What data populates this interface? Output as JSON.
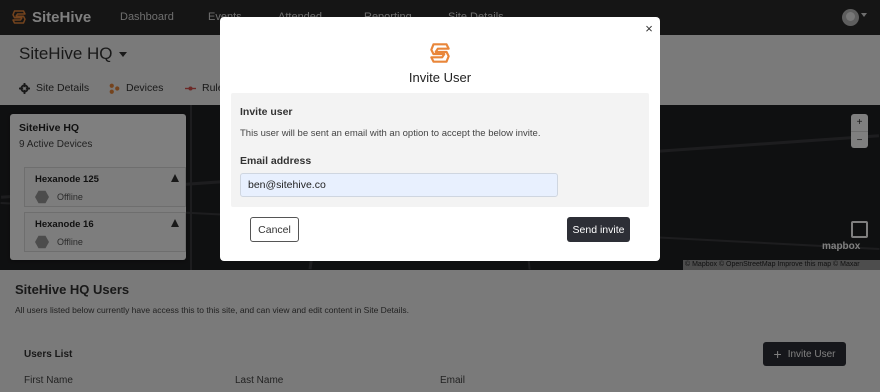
{
  "app": {
    "name": "SiteHive"
  },
  "nav": {
    "links": [
      "Dashboard",
      "Events",
      "Attended",
      "Reporting",
      "Site Details"
    ]
  },
  "site": {
    "title": "SiteHive HQ"
  },
  "subnav": {
    "items": [
      "Site Details",
      "Devices",
      "Rules"
    ]
  },
  "map_card": {
    "title": "SiteHive HQ",
    "count": "9 Active Devices",
    "devices": [
      {
        "name": "Hexanode 125",
        "status": "Offline"
      },
      {
        "name": "Hexanode 16",
        "status": "Offline"
      }
    ]
  },
  "map": {
    "zoom_in": "+",
    "zoom_out": "−",
    "logo": "mapbox",
    "attribution": "© Mapbox © OpenStreetMap Improve this map © Maxar"
  },
  "users": {
    "title": "SiteHive HQ Users",
    "description": "All users listed below currently have access this to this site, and can view and edit content in Site Details.",
    "list_title": "Users List",
    "invite_label": "Invite User",
    "columns": [
      "First Name",
      "Last Name",
      "Email"
    ]
  },
  "modal": {
    "title": "Invite User",
    "close": "×",
    "heading": "Invite user",
    "description": "This user will be sent an email with an option to accept the below invite.",
    "email_label": "Email address",
    "email_value": "ben@sitehive.co",
    "cancel_label": "Cancel",
    "send_label": "Send invite"
  },
  "colors": {
    "brand": "#e9863a",
    "navbar": "#2b2b2b",
    "primary_button": "#2d2f36",
    "input_fill": "#e8f0fe"
  },
  "icons": {
    "brand": "sitehive-logo-icon",
    "subnav": [
      "gear-icon",
      "devices-icon",
      "rules-icon"
    ],
    "warning": "warning-icon",
    "device": "hexagon-icon",
    "plus": "plus-icon",
    "image": "image-icon"
  }
}
